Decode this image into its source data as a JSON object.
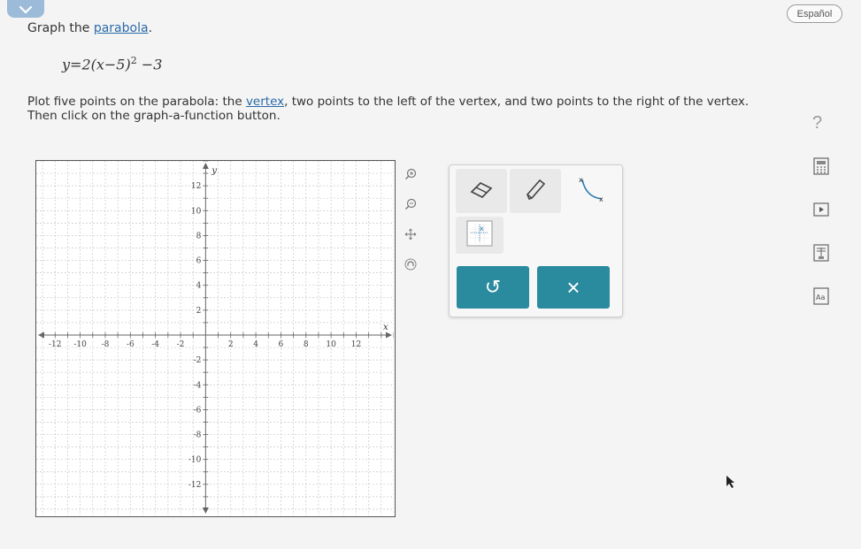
{
  "header": {
    "language_button": "Español"
  },
  "prompt": {
    "intro_text": "Graph the ",
    "intro_link": "parabola",
    "intro_end": ".",
    "equation_lhs": "y=2(x−5)",
    "equation_exp": "2",
    "equation_rhs": " −3",
    "instr_part1": "Plot five points on the parabola: the ",
    "instr_link": "vertex",
    "instr_part2": ", two points to the left of the vertex, and two points to the right of the vertex.",
    "instr_line2": "Then click on the graph-a-function button.",
    "help_symbol": "?"
  },
  "graph": {
    "x_axis_label": "x",
    "y_axis_label": "y",
    "xlim": [
      -13.5,
      15
    ],
    "ylim": [
      -14.5,
      14
    ],
    "x_ticks": [
      "-12",
      "-10",
      "-8",
      "-6",
      "-4",
      "-2",
      "2",
      "4",
      "6",
      "8",
      "10",
      "12"
    ],
    "y_ticks": [
      "12",
      "10",
      "8",
      "6",
      "4",
      "2",
      "-2",
      "-4",
      "-6",
      "-8",
      "-10",
      "-12"
    ],
    "x_tick_values": [
      -12,
      -10,
      -8,
      -6,
      -4,
      -2,
      2,
      4,
      6,
      8,
      10,
      12
    ],
    "y_tick_values": [
      12,
      10,
      8,
      6,
      4,
      2,
      -2,
      -4,
      -6,
      -8,
      -10,
      -12
    ],
    "grid": true
  },
  "side_tools": [
    "zoom-in-icon",
    "zoom-out-icon",
    "pan-icon",
    "home-icon"
  ],
  "tool_panel": {
    "tools": [
      "eraser-icon",
      "pencil-icon",
      "curve-tool-icon",
      "graph-function-icon"
    ],
    "undo_symbol": "↺",
    "clear_symbol": "×"
  },
  "right_rail": [
    "calculator-icon",
    "video-icon",
    "textbook-icon",
    "glossary-icon"
  ],
  "right_rail_text": {
    "glossary_label": "Aa"
  },
  "colors": {
    "link": "#2a6aa8",
    "action_button": "#2a8a9e",
    "collapse_tab": "#9bbbd9"
  }
}
